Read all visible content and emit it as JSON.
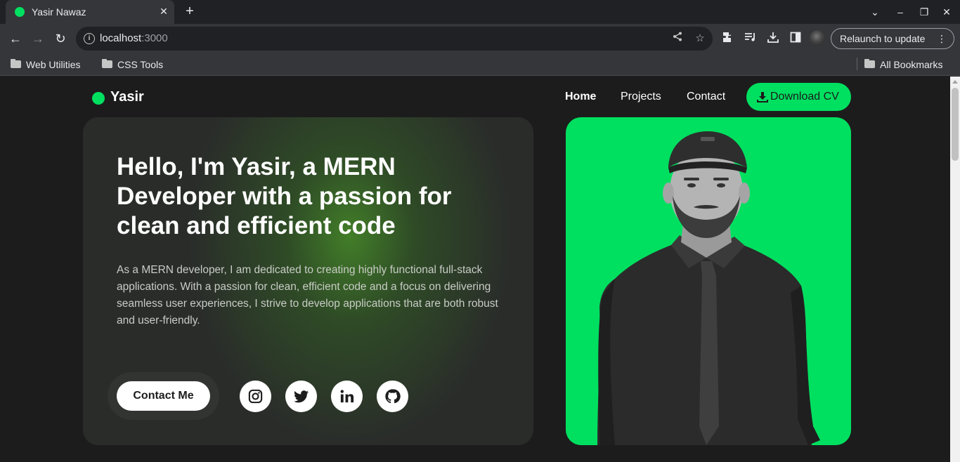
{
  "browser": {
    "tab_title": "Yasir Nawaz",
    "url_host": "localhost",
    "url_port": ":3000",
    "relaunch_label": "Relaunch to update",
    "bookmarks": [
      "Web Utilities",
      "CSS Tools"
    ],
    "all_bookmarks_label": "All Bookmarks"
  },
  "site": {
    "brand": "Yasir",
    "nav": [
      "Home",
      "Projects",
      "Contact"
    ],
    "active_nav": "Home",
    "cv_button": "Download CV"
  },
  "hero": {
    "title": "Hello, I'm Yasir, a MERN Developer with a passion for clean and efficient code",
    "description": "As a MERN developer, I am dedicated to creating highly functional full-stack applications. With a passion for clean, efficient code and a focus on delivering seamless user experiences, I strive to develop applications that are both robust and user-friendly.",
    "contact_button": "Contact Me",
    "socials": [
      "instagram-icon",
      "twitter-icon",
      "linkedin-icon",
      "github-icon"
    ]
  },
  "colors": {
    "accent": "#00e060",
    "page_bg": "#1c1c1c",
    "card_bg": "#2a2c2a"
  }
}
